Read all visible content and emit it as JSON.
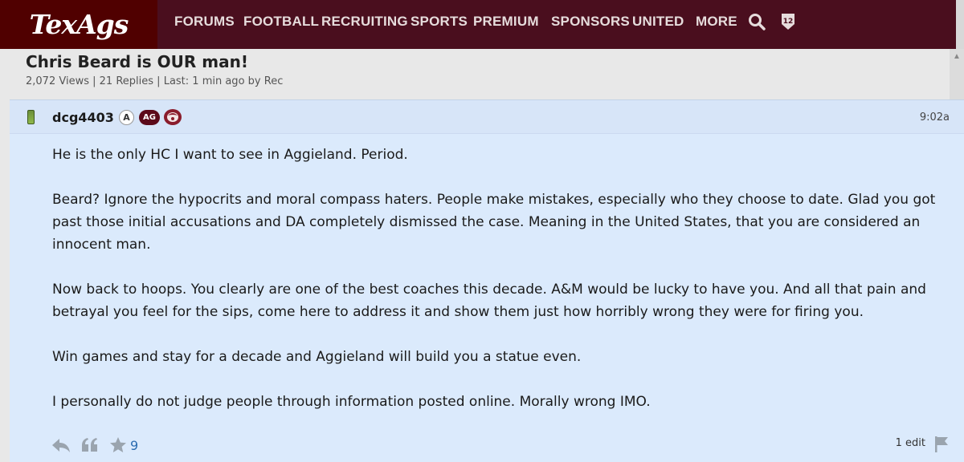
{
  "nav": {
    "logo": "TexAgs",
    "items": [
      "FORUMS",
      "FOOTBALL",
      "RECRUITING",
      "SPORTS",
      "PREMIUM",
      "SPONSORS",
      "UNITED",
      "MORE"
    ],
    "theme_color": "#4a0e1e",
    "logo_color": "#500000"
  },
  "thread": {
    "title": "Chris Beard is OUR man!",
    "views": "2,072 Views",
    "replies": "21 Replies",
    "last": "Last: 1 min ago by",
    "last_user": "Rec",
    "sep": "|"
  },
  "post": {
    "username": "dcg4403",
    "badge_a": "A",
    "badge_ag": "AG",
    "time": "9:02a",
    "paragraphs": [
      "He is the only HC I want to see in Aggieland. Period.",
      "Beard? Ignore the hypocrits and moral compass haters. People make mistakes, especially who they choose to date. Glad you got past those initial accusations and DA completely dismissed the case. Meaning in the United States, that you are considered an innocent man.",
      "Now back to hoops. You clearly are one of the best coaches this decade. A&M would be lucky to have you. And all that pain and betrayal you feel for the sips, come here to address it and show them just how horribly wrong they were for firing you.",
      "Win games and stay for a decade and Aggieland will build you a statue even.",
      "I personally do not judge people through information posted online. Morally wrong IMO."
    ],
    "star_count": "9",
    "edits": "1 edit",
    "bg_color": "#dbeafc"
  },
  "icons": {
    "search": "search-icon",
    "twelfth_man": "twelfth-man-icon",
    "phone": "phone-icon",
    "reply": "reply-icon",
    "quote": "quote-icon",
    "star": "star-icon",
    "flag": "flag-icon"
  }
}
